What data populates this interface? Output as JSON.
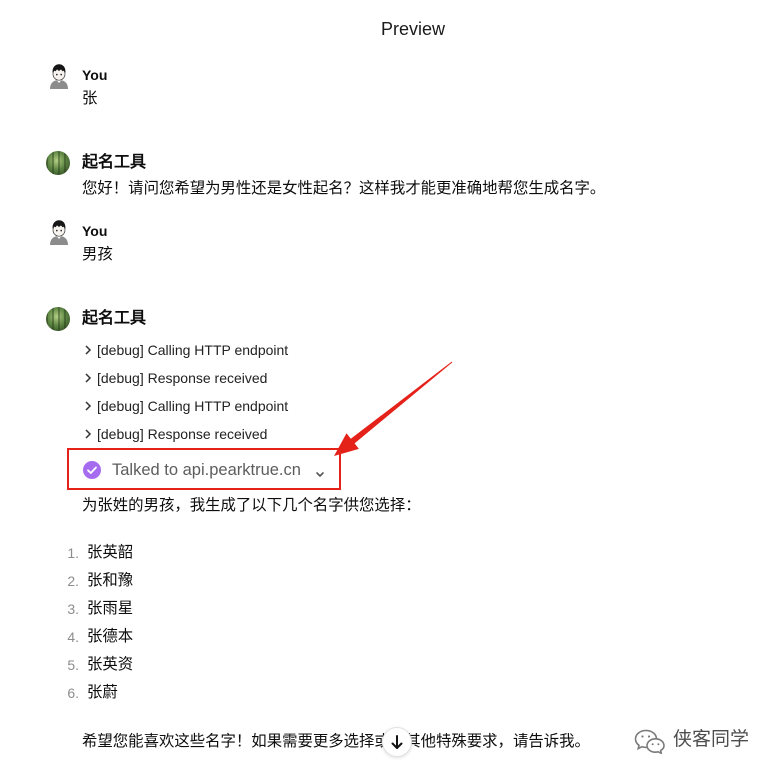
{
  "header": {
    "title": "Preview"
  },
  "messages": [
    {
      "author": "You",
      "avatar_icon": "user-avatar-icon",
      "text": "张"
    },
    {
      "author": "起名工具",
      "avatar_icon": "bot-avatar-icon",
      "text": "您好！请问您希望为男性还是女性起名？这样我才能更准确地帮您生成名字。"
    },
    {
      "author": "You",
      "avatar_icon": "user-avatar-icon",
      "text": "男孩"
    },
    {
      "author": "起名工具",
      "avatar_icon": "bot-avatar-icon",
      "debug_lines": [
        "[debug] Calling HTTP endpoint",
        "[debug] Response received",
        "[debug] Calling HTTP endpoint",
        "[debug] Response received"
      ],
      "debug_icon": "chevron-right-icon",
      "tool_call": {
        "label": "Talked to api.pearktrue.cn",
        "status_icon": "check-circle-icon",
        "expand_icon": "chevron-down-icon"
      },
      "intro": "为张姓的男孩，我生成了以下几个名字供您选择：",
      "names": [
        {
          "number": "1.",
          "name": "张英韶"
        },
        {
          "number": "2.",
          "name": "张和豫"
        },
        {
          "number": "3.",
          "name": "张雨星"
        },
        {
          "number": "4.",
          "name": "张德本"
        },
        {
          "number": "5.",
          "name": "张英资"
        },
        {
          "number": "6.",
          "name": "张蔚"
        }
      ],
      "closing": "希望您能喜欢这些名字！如果需要更多选择或有其他特殊要求，请告诉我。"
    }
  ],
  "scroll_button": {
    "icon": "arrow-down-icon"
  },
  "watermark": {
    "icon": "wechat-icon",
    "text": "侠客同学"
  },
  "colors": {
    "accent_purple": "#a56cf0",
    "annotation_red": "#e5221a",
    "text": "#0d0d0d",
    "muted_text": "#5d5d5d",
    "list_number": "#8d8d8d"
  }
}
